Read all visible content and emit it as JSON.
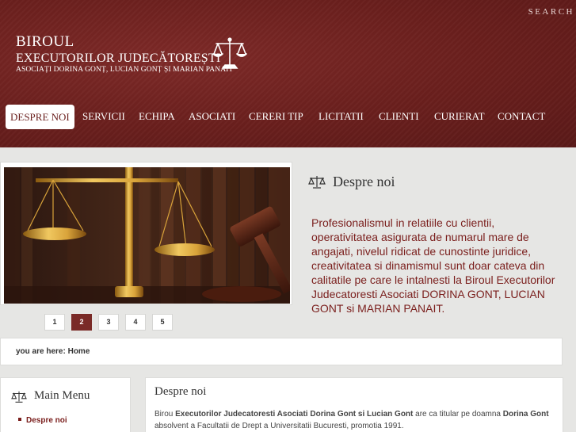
{
  "header": {
    "search_label": "SEARCH",
    "logo": {
      "line1": "BIROUL",
      "line2": "EXECUTORILOR JUDECĂTOREȘTI",
      "line3": "ASOCIAȚI DORINA GONȚ, LUCIAN GONȚ ȘI MARIAN PANAIT",
      "icon": "scales-of-justice-icon"
    },
    "nav": [
      {
        "label": "DESPRE NOI",
        "active": true
      },
      {
        "label": "SERVICII"
      },
      {
        "label": "ECHIPA"
      },
      {
        "label": "ASOCIATI"
      },
      {
        "label": "CERERI TIP"
      },
      {
        "label": "LICITATII"
      },
      {
        "label": "CLIENTI"
      },
      {
        "label": "CURIERAT"
      },
      {
        "label": "CONTACT"
      }
    ]
  },
  "slider": {
    "image": "scales-and-gavel-photo",
    "pages": [
      "1",
      "2",
      "3",
      "4",
      "5"
    ],
    "active_page": "2"
  },
  "intro": {
    "icon": "scales-icon",
    "title": "Despre noi",
    "text": "Profesionalismul in relatiile cu clientii, operativitatea asigurata de numarul mare de angajati, nivelul ridicat de cunostinte juridice, creativitatea si dinamismul sunt doar cateva din calitatile pe care le intalnesti la Biroul Executorilor Judecatoresti Asociati DORINA GONT, LUCIAN GONT si MARIAN PANAIT."
  },
  "breadcrumb": {
    "prefix": "you are here: ",
    "current": "Home"
  },
  "main_menu": {
    "icon": "scales-icon",
    "title": "Main Menu",
    "items": [
      "Despre noi"
    ]
  },
  "content": {
    "title": "Despre noi",
    "parts": {
      "p1": "Birou ",
      "b1": "Executorilor Judecatoresti Asociati Dorina Gont si Lucian Gont",
      "p2": " are ca titular pe doamna ",
      "b2": "Dorina Gont",
      "p3": " absolvent a Facultatii de Drept a Universitatii Bucuresti, promotia 1991."
    }
  },
  "colors": {
    "header_bg": "#6a1f1d",
    "accent": "#7a1e1c",
    "page_bg": "#e6e6e4"
  }
}
